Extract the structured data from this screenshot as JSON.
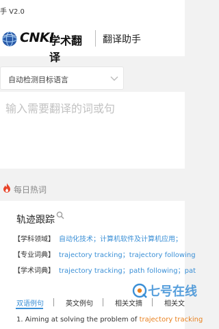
{
  "window": {
    "title": "手 V2.0"
  },
  "header": {
    "logo_latin": "CNKI",
    "logo_cn": "学术翻译",
    "subtitle": "翻译助手"
  },
  "language": {
    "selected": "自动检测目标语言"
  },
  "input": {
    "placeholder": "输入需要翻译的词或句"
  },
  "hot": {
    "title": "每日热词"
  },
  "entry": {
    "term": "轨迹跟踪",
    "rows": [
      {
        "key": "【学科领域】",
        "value": "自动化技术；计算机软件及计算机应用；"
      },
      {
        "key": "【专业词典】",
        "value": "trajectory tracking；trajectory following"
      },
      {
        "key": "【学术词典】",
        "value": "trajectory tracking；path following；pat"
      }
    ]
  },
  "tabs": [
    {
      "label": "双语例句",
      "active": true
    },
    {
      "label": "英文例句",
      "active": false
    },
    {
      "label": "相关文摘",
      "active": false
    },
    {
      "label": "相关文",
      "active": false
    }
  ],
  "example": {
    "prefix": "1. Aiming at solving the problem of ",
    "highlight": "trajectory tracking"
  },
  "watermark": {
    "text": "七号在线"
  },
  "colors": {
    "accent": "#3a8fd6",
    "highlight": "#e8801e",
    "fire": "#e8452a"
  }
}
